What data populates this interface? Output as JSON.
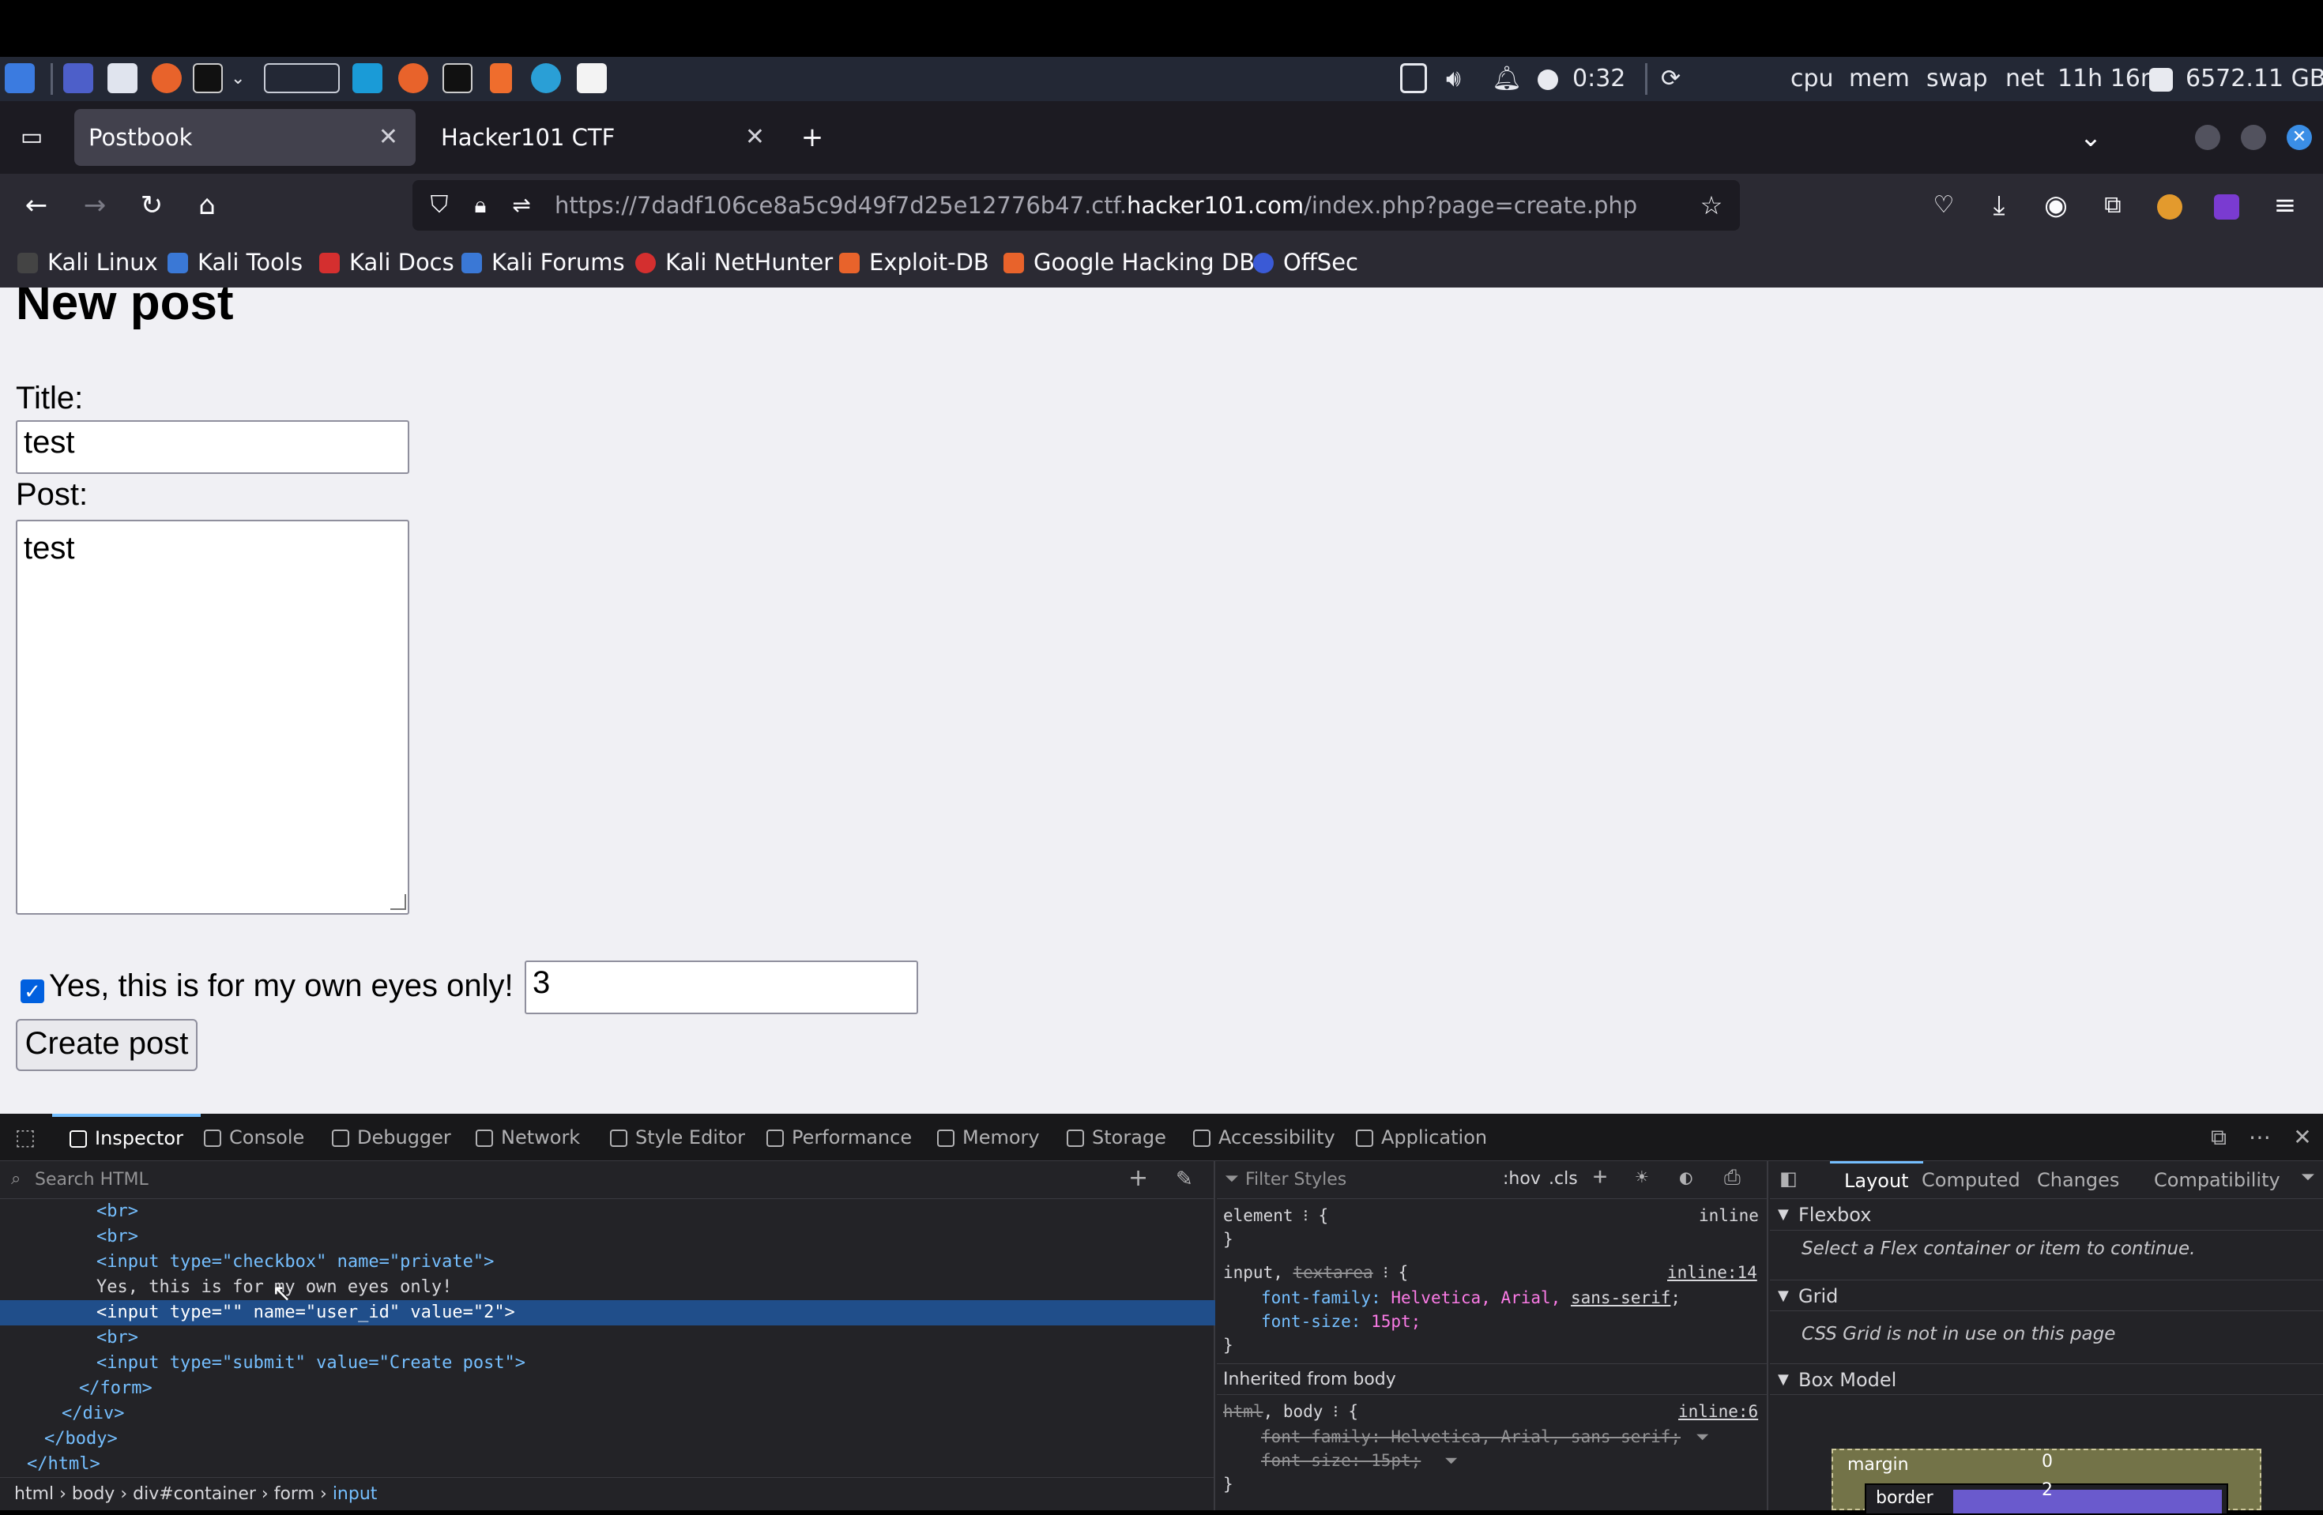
{
  "taskbar": {
    "timer": "0:32",
    "cpu": "cpu",
    "mem": "mem",
    "swap": "swap",
    "net": "net",
    "uptime": "11h 16m",
    "disk": "6572.11 GB"
  },
  "tabs": [
    {
      "label": "Postbook",
      "active": true
    },
    {
      "label": "Hacker101 CTF",
      "active": false
    }
  ],
  "url": {
    "prefix": "https://7dadf106ce8a5c9d49f7d25e12776b47.ctf.",
    "host": "hacker101.com",
    "path": "/index.php?page=create.php"
  },
  "bookmarks": [
    "Kali Linux",
    "Kali Tools",
    "Kali Docs",
    "Kali Forums",
    "Kali NetHunter",
    "Exploit-DB",
    "Google Hacking DB",
    "OffSec"
  ],
  "page": {
    "heading": "New post",
    "title_label": "Title:",
    "title_value": "test",
    "post_label": "Post:",
    "post_value": "test",
    "private_label": "Yes, this is for my own eyes only!",
    "private_checked": true,
    "user_id_value": "3",
    "submit_label": "Create post"
  },
  "devtools": {
    "tabs": [
      "Inspector",
      "Console",
      "Debugger",
      "Network",
      "Style Editor",
      "Performance",
      "Memory",
      "Storage",
      "Accessibility",
      "Application"
    ],
    "search_placeholder": "Search HTML",
    "markup_lines": [
      "<br>",
      "<br>",
      "<input type=\"checkbox\" name=\"private\">",
      "Yes, this is for my own eyes only!",
      "<input type=\"\" name=\"user_id\" value=\"2\">",
      "<br>",
      "<input type=\"submit\" value=\"Create post\">",
      "</form>",
      "</div>",
      "</body>",
      "</html>"
    ],
    "breadcrumbs": [
      "html",
      "body",
      "div#container",
      "form",
      "input"
    ],
    "filter_placeholder": "Filter Styles",
    "hov": ":hov",
    "cls": ".cls",
    "rules": {
      "element_selector": "element",
      "element_source": "inline",
      "input_selector": "input,",
      "textarea_selector": "textarea",
      "input_source": "inline:14",
      "font_family_prop": "font-family:",
      "font_family_val": "Helvetica, Arial,",
      "font_family_generic": "sans-serif",
      "font_size_prop": "font-size:",
      "font_size_val": "15pt;",
      "inherited_header": "Inherited from body",
      "body_selector_html": "html",
      "body_selector_body": ", body",
      "body_source": "inline:6",
      "body_font_family": "font-family: Helvetica, Arial, sans-serif;",
      "body_font_size": "font-size: 15pt;"
    },
    "layout_tabs": [
      "Layout",
      "Computed",
      "Changes",
      "Compatibility"
    ],
    "flexbox_header": "Flexbox",
    "flexbox_note": "Select a Flex container or item to continue.",
    "grid_header": "Grid",
    "grid_note": "CSS Grid is not in use on this page",
    "boxmodel_header": "Box Model",
    "boxmodel_margin_label": "margin",
    "boxmodel_margin_value": "0",
    "boxmodel_border_label": "border",
    "boxmodel_border_value": "2"
  }
}
